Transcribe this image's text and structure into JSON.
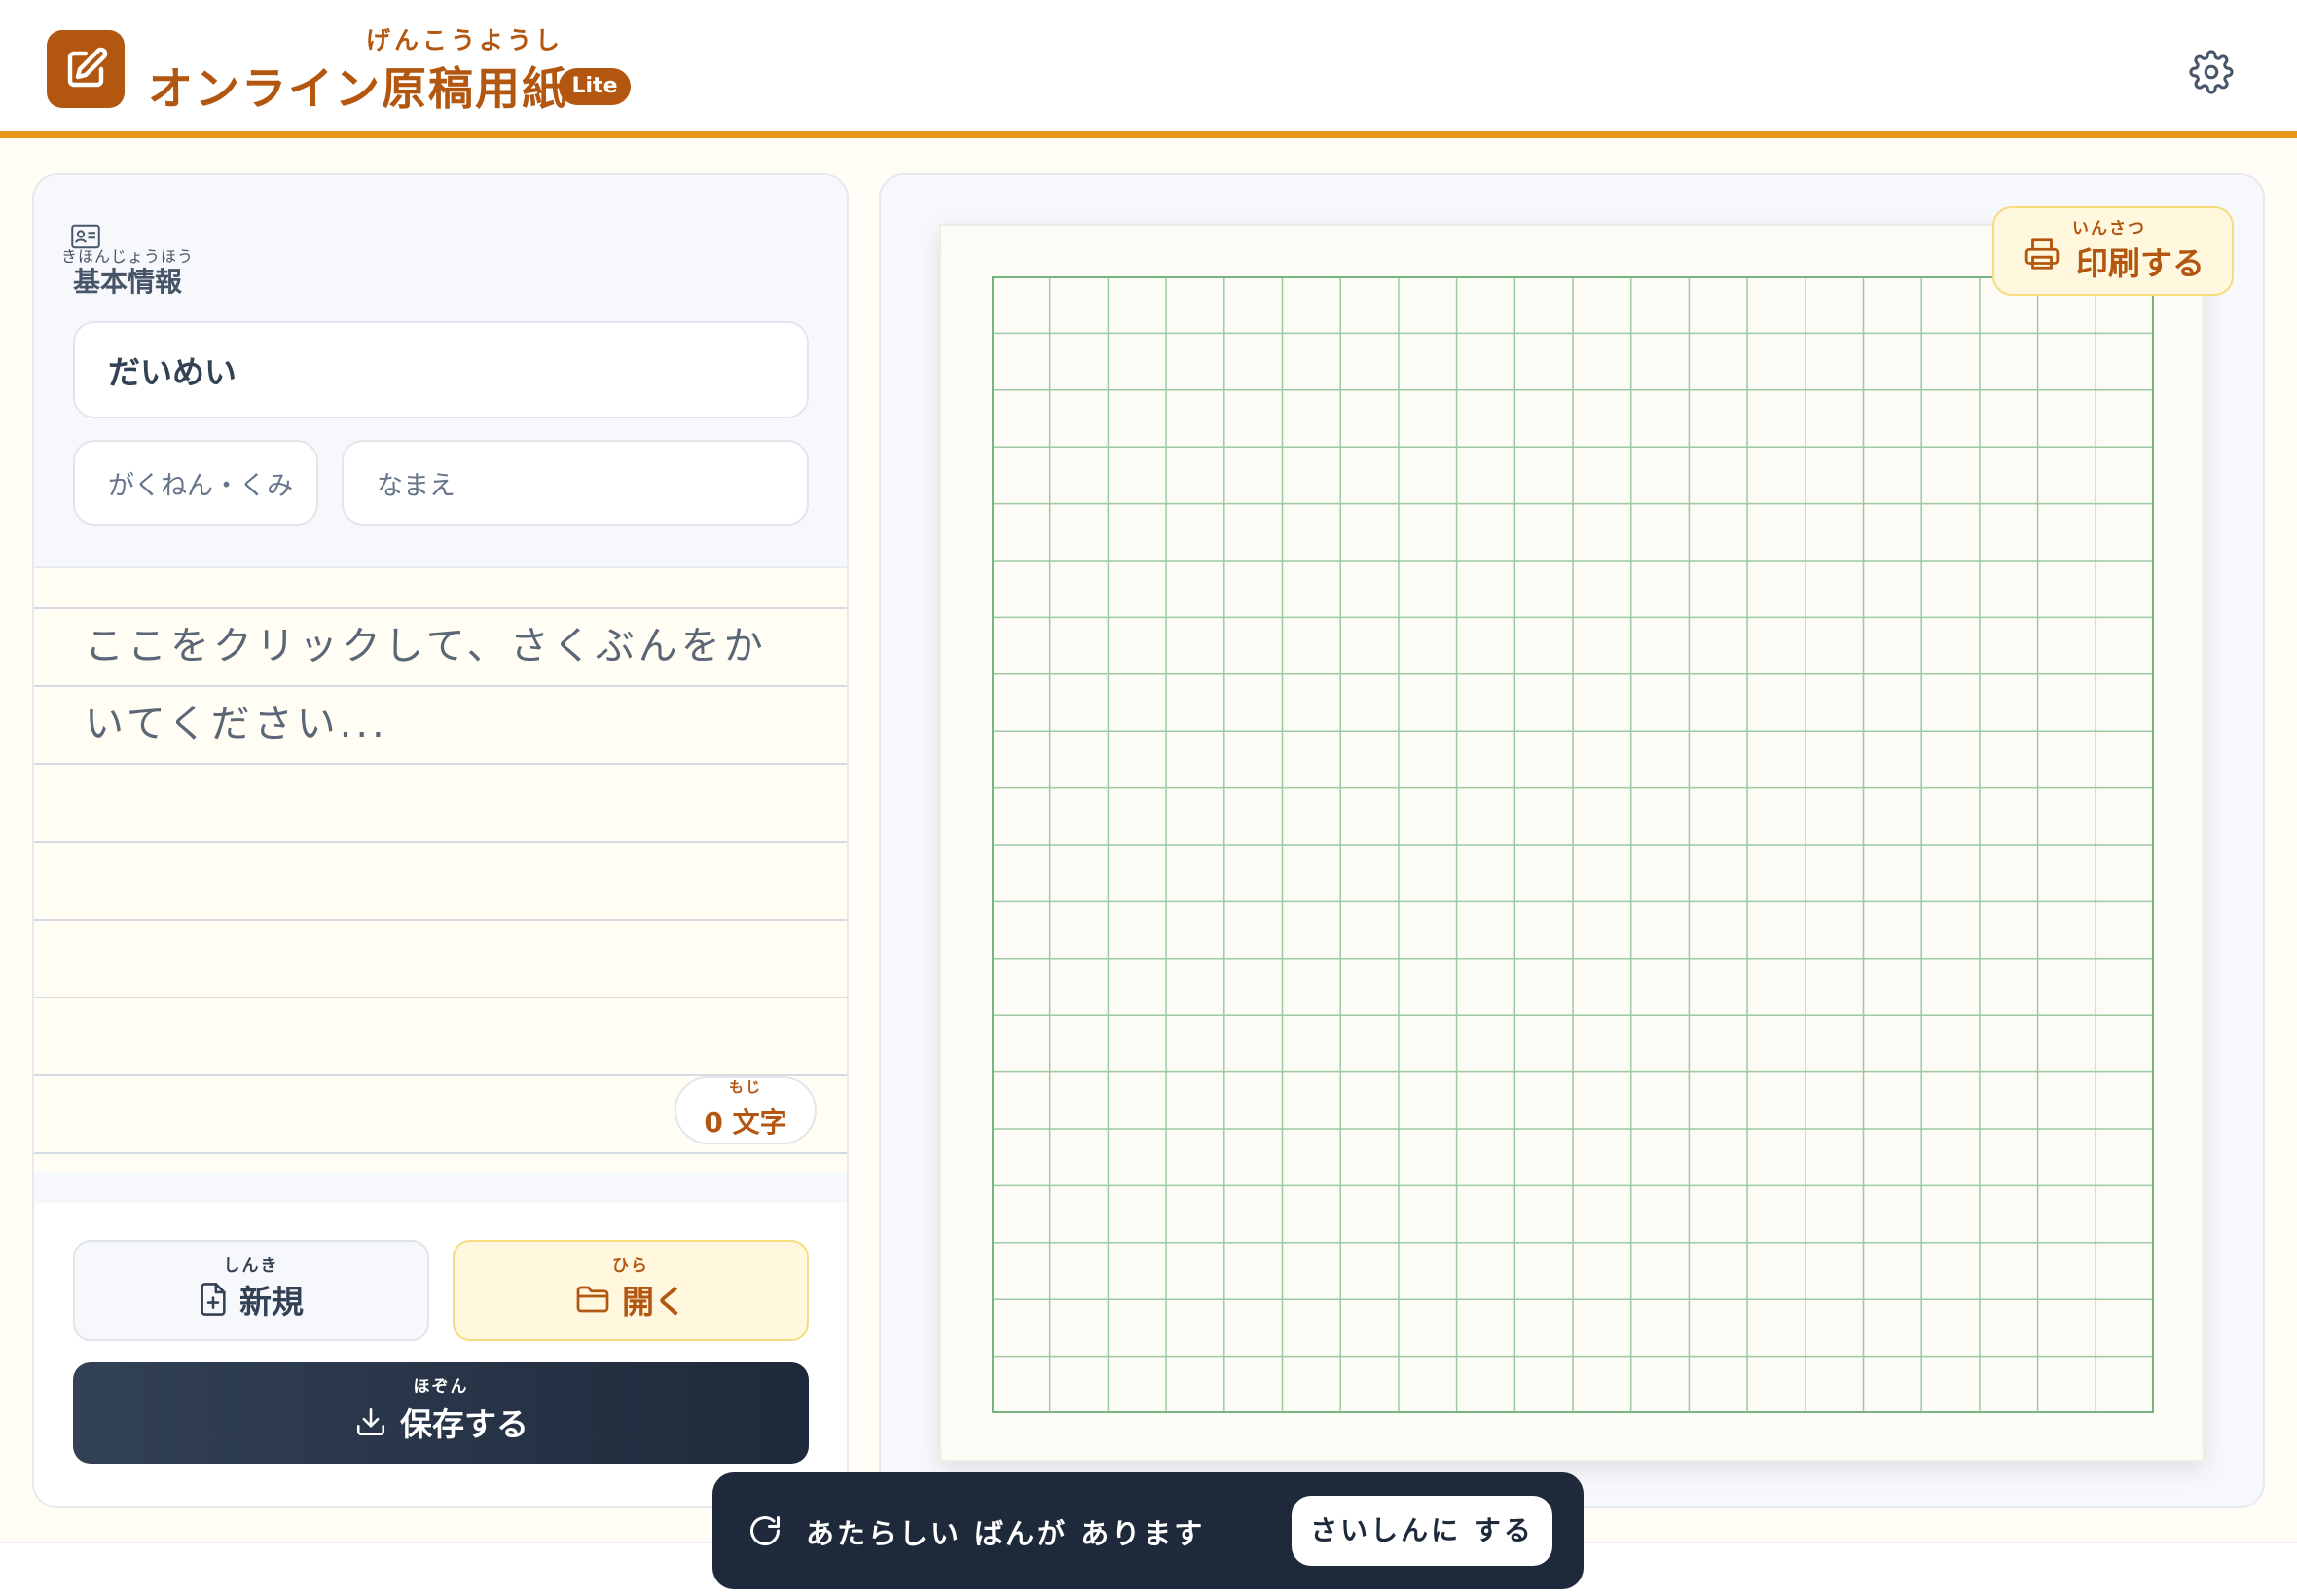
{
  "header": {
    "title_ruby": "げんこうようし",
    "title": "オンライン原稿用紙",
    "badge": "Lite",
    "icons": {
      "app": "edit-square-icon",
      "settings": "gear-icon"
    }
  },
  "sidebar": {
    "basic_info": {
      "ruby": "きほんじょうほう",
      "label": "基本情報",
      "icon": "id-card-icon"
    },
    "fields": {
      "title_placeholder": "だいめい",
      "grade_placeholder": "がくねん・くみ",
      "name_placeholder": "なまえ"
    },
    "editor": {
      "placeholder": "ここをクリックして、さくぶんをかいてください..."
    },
    "char_count": {
      "ruby": "もじ",
      "value": "0",
      "unit": "文字"
    },
    "buttons": {
      "new": {
        "ruby": "しんき",
        "label": "新規",
        "icon": "file-plus-icon"
      },
      "open": {
        "ruby": "ひら",
        "label": "開く",
        "icon": "folder-icon"
      },
      "save": {
        "ruby": "ほぞん",
        "label": "保存する",
        "icon": "download-icon"
      }
    }
  },
  "preview": {
    "print_button": {
      "ruby": "いんさつ",
      "label": "印刷する",
      "icon": "printer-icon"
    },
    "grid": {
      "columns": 20,
      "rows": 20,
      "line_color": "#9ccaa2",
      "border_color": "#78b482"
    }
  },
  "toast": {
    "message": "あたらしい ばんが あります",
    "button": "さいしんに する",
    "icon": "refresh-icon"
  },
  "colors": {
    "brand": "#b3560f",
    "accent": "#e8961e",
    "dark": "#1e293b"
  }
}
